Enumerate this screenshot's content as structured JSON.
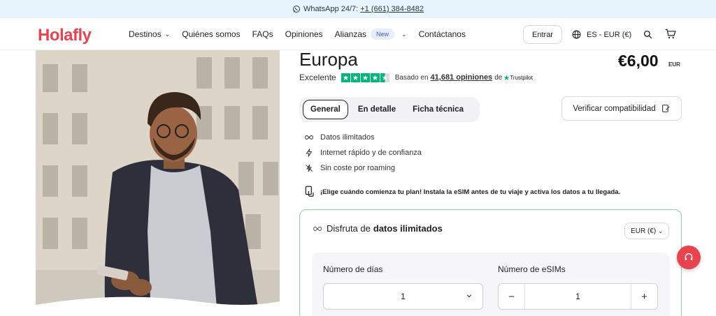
{
  "topbar": {
    "whatsapp_label": "WhatsApp 24/7:",
    "phone": "+1 (661) 384-8482"
  },
  "header": {
    "logo": "Holafly",
    "nav": {
      "destinos": "Destinos",
      "quienes": "Quiénes somos",
      "faqs": "FAQs",
      "opiniones": "Opiniones",
      "alianzas": "Alianzas",
      "alianzas_badge": "New",
      "contactanos": "Contáctanos"
    },
    "login_label": "Entrar",
    "language": "ES - EUR (€)"
  },
  "product": {
    "title": "Europa",
    "price": "€6,00",
    "price_currency": "EUR",
    "rating_label": "Excelente",
    "rating_stars": 4.5,
    "based_on": "Basado en",
    "reviews_count": "41,681 opiniones",
    "reviews_suffix": "de",
    "trustpilot": "Trustpilot"
  },
  "tabs": {
    "general": "General",
    "detalle": "En detalle",
    "ficha": "Ficha técnica"
  },
  "verify_label": "Verificar compatibilidad",
  "features": [
    {
      "icon": "infinity-icon",
      "label": "Datos ilimitados"
    },
    {
      "icon": "lightning-icon",
      "label": "Internet rápido y de confianza"
    },
    {
      "icon": "no-roaming-icon",
      "label": "Sin coste por roaming"
    }
  ],
  "notice": "¡Elige cuándo comienza tu plan! Instala la eSIM antes de tu viaje y activa los datos a tu llegada.",
  "plan": {
    "title_prefix": "Disfruta de",
    "title_bold": "datos ilimitados",
    "currency": "EUR (€)",
    "days_label": "Número de días",
    "days_value": "1",
    "esims_label": "Número de eSIMs",
    "esims_value": "1"
  },
  "colors": {
    "brand": "#e8434f",
    "trustpilot_green": "#00b67a",
    "plan_border": "#7fd99a",
    "topbar_bg": "#e7f4fb"
  }
}
